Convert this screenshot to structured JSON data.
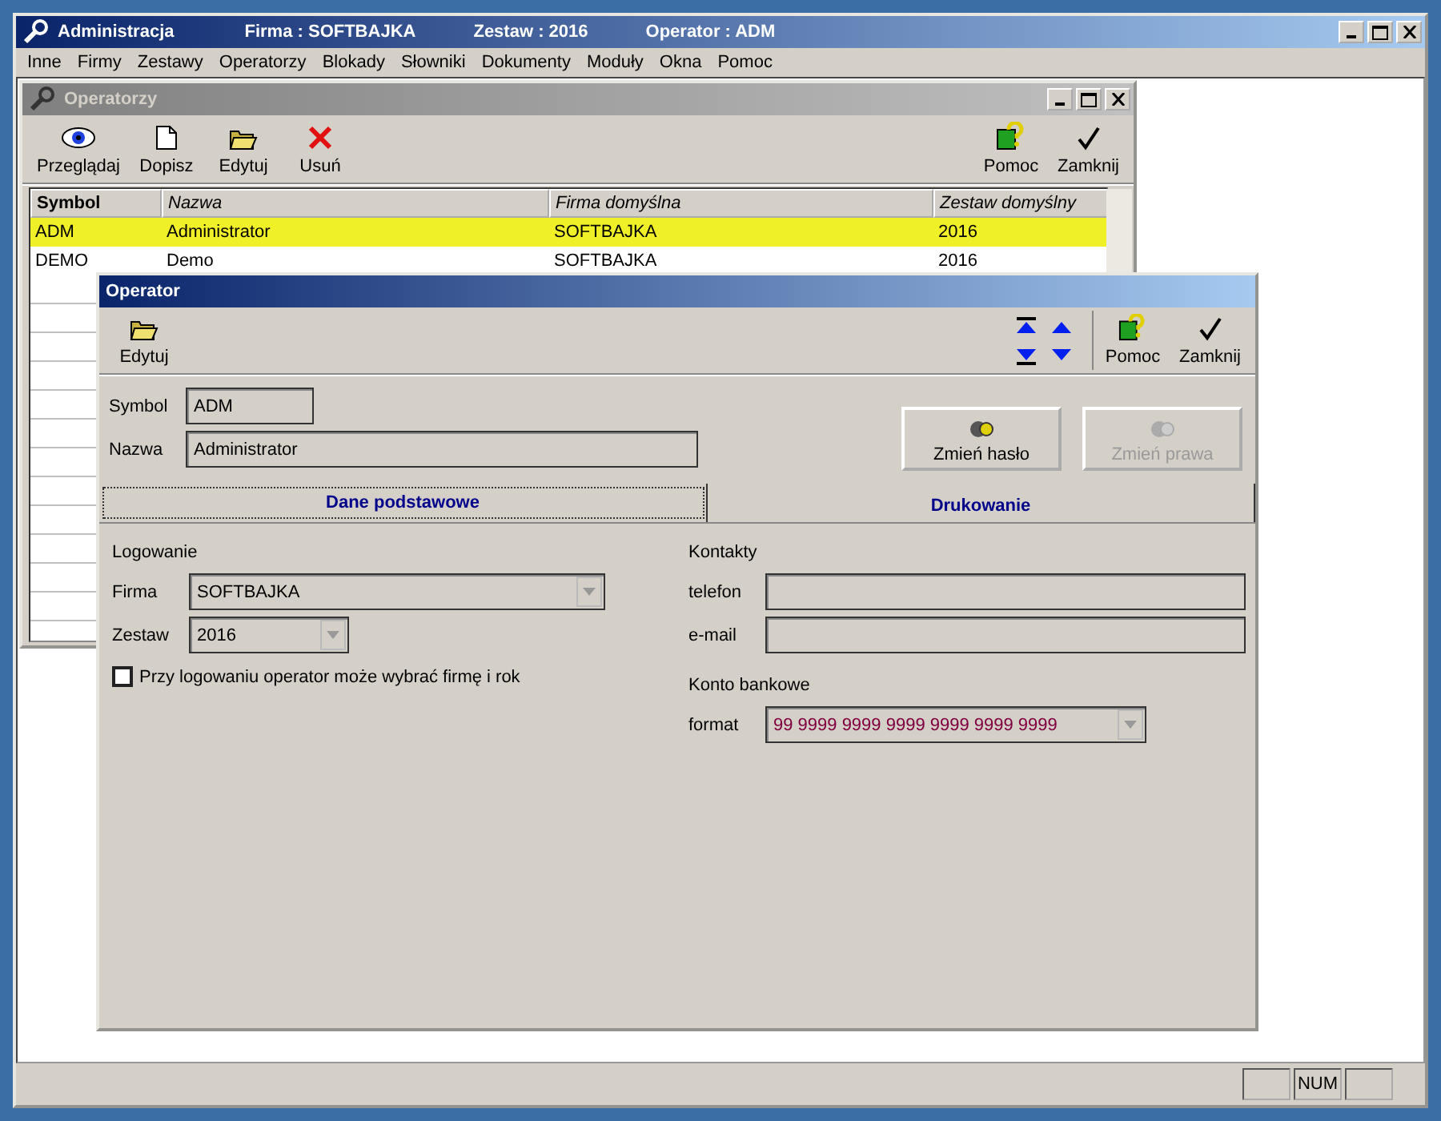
{
  "window": {
    "title": "Administracja",
    "context": [
      {
        "label": "Firma : SOFTBAJKA"
      },
      {
        "label": "Zestaw : 2016"
      },
      {
        "label": "Operator : ADM"
      }
    ]
  },
  "menu": [
    "Inne",
    "Firmy",
    "Zestawy",
    "Operatorzy",
    "Blokady",
    "Słowniki",
    "Dokumenty",
    "Moduły",
    "Okna",
    "Pomoc"
  ],
  "operators_window": {
    "title": "Operatorzy",
    "active": false,
    "toolbar_left": [
      {
        "kind": "view",
        "label": "Przeglądaj"
      },
      {
        "kind": "new",
        "label": "Dopisz"
      },
      {
        "kind": "edit",
        "label": "Edytuj"
      },
      {
        "kind": "delete",
        "label": "Usuń"
      }
    ],
    "toolbar_right": [
      {
        "kind": "help",
        "label": "Pomoc"
      },
      {
        "kind": "close",
        "label": "Zamknij"
      }
    ],
    "table": {
      "columns": [
        {
          "label": "Symbol",
          "bold": true
        },
        {
          "label": "Nazwa",
          "bold": false
        },
        {
          "label": "Firma domyślna",
          "bold": false
        },
        {
          "label": "Zestaw domyślny",
          "bold": false
        }
      ],
      "rows": [
        {
          "cells": [
            "ADM",
            "Administrator",
            "SOFTBAJKA",
            "2016"
          ],
          "selected": true
        },
        {
          "cells": [
            "DEMO",
            "Demo",
            "SOFTBAJKA",
            "2016"
          ],
          "selected": false
        }
      ]
    }
  },
  "operator_dialog": {
    "title": "Operator",
    "active": true,
    "toolbar_left": [
      {
        "kind": "edit",
        "label": "Edytuj"
      }
    ],
    "nav": [
      {
        "kind": "first"
      },
      {
        "kind": "prev"
      },
      {
        "kind": "last"
      },
      {
        "kind": "next"
      }
    ],
    "toolbar_right": [
      {
        "kind": "help",
        "label": "Pomoc"
      },
      {
        "kind": "close",
        "label": "Zamknij"
      }
    ],
    "symbol": {
      "label": "Symbol",
      "value": "ADM"
    },
    "name": {
      "label": "Nazwa",
      "value": "Administrator"
    },
    "buttons": [
      {
        "label": "Zmień hasło",
        "disabled": false
      },
      {
        "label": "Zmień prawa",
        "disabled": true
      }
    ],
    "tabs": [
      {
        "label": "Dane podstawowe",
        "selected": true
      },
      {
        "label": "Drukowanie",
        "selected": false
      }
    ],
    "login": {
      "heading": "Logowanie",
      "firm": {
        "label": "Firma",
        "value": "SOFTBAJKA"
      },
      "set": {
        "label": "Zestaw",
        "value": "2016"
      },
      "checkbox": {
        "label": "Przy logowaniu operator może wybrać firmę i rok",
        "checked": false
      }
    },
    "contacts": {
      "heading": "Kontakty",
      "phone": {
        "label": "telefon"
      },
      "email": {
        "label": "e-mail"
      }
    },
    "bank": {
      "heading": "Konto bankowe",
      "format": {
        "label": "format",
        "value": "99 9999 9999 9999 9999 9999 9999"
      }
    }
  },
  "status_bar": {
    "indicator": "NUM"
  }
}
